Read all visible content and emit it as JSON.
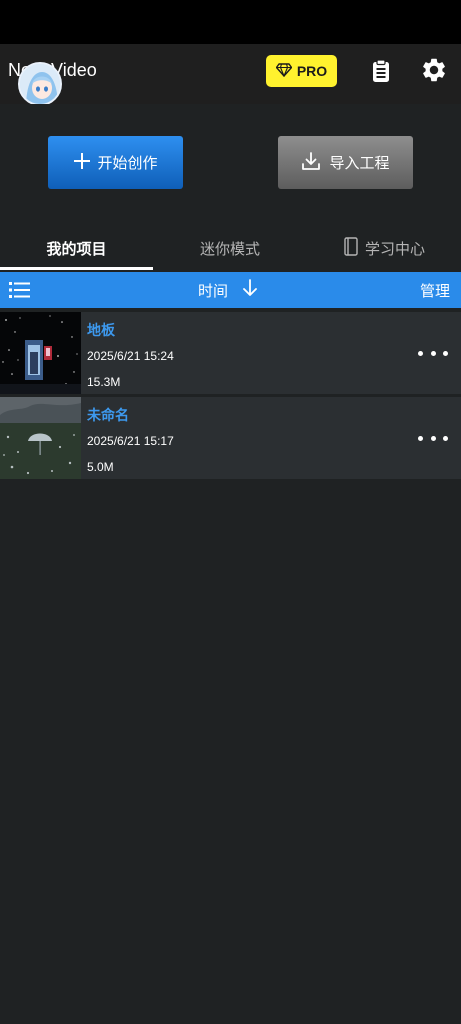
{
  "header": {
    "app_title": "Nodevideo",
    "app_title_visible": "No    Video",
    "pro_label": "PRO",
    "icons": [
      "avatar",
      "diamond-icon",
      "clipboard-icon",
      "gear-icon"
    ]
  },
  "actions": {
    "create_label": "开始创作",
    "import_label": "导入工程"
  },
  "tabs": [
    {
      "label": "我的项目",
      "active": true
    },
    {
      "label": "迷你模式",
      "active": false
    },
    {
      "label": "学习中心",
      "active": false,
      "icon": "book-icon"
    }
  ],
  "sort_bar": {
    "sort_label": "时间",
    "manage_label": "管理",
    "icons": [
      "list-icon",
      "arrow-down-icon"
    ]
  },
  "projects": [
    {
      "name": "地板",
      "date": "2025/6/21 15:24",
      "size": "15.3M",
      "thumbnail": "night-portal-scene"
    },
    {
      "name": "未命名",
      "date": "2025/6/21 15:17",
      "size": "5.0M",
      "thumbnail": "umbrella-meadow-scene"
    }
  ],
  "colors": {
    "accent_blue": "#2a8bea",
    "project_name_blue": "#3d99ee",
    "pro_yellow": "#fff22e",
    "background": "#1f2223",
    "row_background": "#2b2f32"
  }
}
